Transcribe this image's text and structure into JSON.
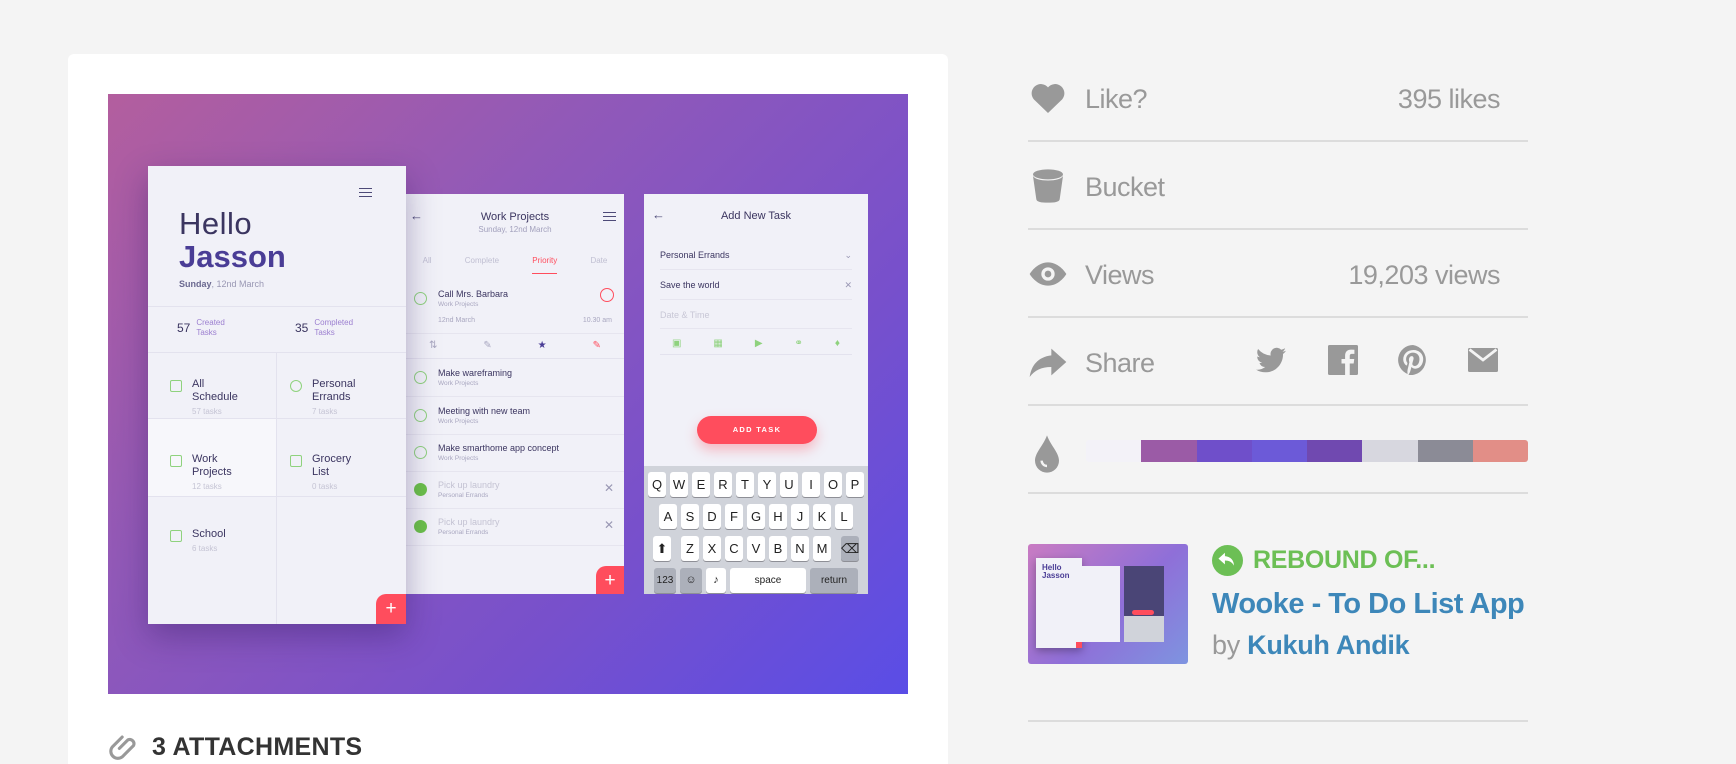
{
  "attachments": {
    "label": "3 ATTACHMENTS"
  },
  "shot": {
    "home": {
      "hello": "Hello",
      "name": "Jasson",
      "day": "Sunday",
      "date": ", 12nd March",
      "created_n": "57",
      "created_l1": "Created",
      "created_l2": "Tasks",
      "completed_n": "35",
      "completed_l1": "Completed",
      "completed_l2": "Tasks",
      "categories": [
        {
          "line1": "All",
          "line2": "Schedule",
          "count": "57 tasks"
        },
        {
          "line1": "Personal",
          "line2": "Errands",
          "count": "7 tasks"
        },
        {
          "line1": "Work",
          "line2": "Projects",
          "count": "12 tasks"
        },
        {
          "line1": "Grocery",
          "line2": "List",
          "count": "0 tasks"
        },
        {
          "line1": "School",
          "line2": "",
          "count": "6 tasks"
        }
      ],
      "fab": "+"
    },
    "projects": {
      "title": "Work Projects",
      "subtitle": "Sunday, 12nd March",
      "tabs": [
        "All",
        "Complete",
        "Priority",
        "Date"
      ],
      "tasks": [
        {
          "title": "Call Mrs. Barbara",
          "sub": "Work Projects",
          "date": "12nd March",
          "time": "10.30 am"
        },
        {
          "title": "Make wareframing",
          "sub": "Work Projects"
        },
        {
          "title": "Meeting with new team",
          "sub": "Work Projects"
        },
        {
          "title": "Make smarthome app concept",
          "sub": "Work Projects"
        },
        {
          "title": "Pick up laundry",
          "sub": "Personal Errands"
        },
        {
          "title": "Pick up laundry",
          "sub": "Personal Errands"
        }
      ]
    },
    "newtask": {
      "title": "Add New Task",
      "category": "Personal Errands",
      "name": "Save the world",
      "datetime_placeholder": "Date & Time",
      "button": "ADD TASK",
      "kb_row1": [
        "Q",
        "W",
        "E",
        "R",
        "T",
        "Y",
        "U",
        "I",
        "O",
        "P"
      ],
      "kb_row2": [
        "A",
        "S",
        "D",
        "F",
        "G",
        "H",
        "J",
        "K",
        "L"
      ],
      "kb_row3": [
        "Z",
        "X",
        "C",
        "V",
        "B",
        "N",
        "M"
      ],
      "kb_num": "123",
      "kb_space": "space",
      "kb_return": "return"
    }
  },
  "sidebar": {
    "like": {
      "label": "Like?",
      "value": "395 likes"
    },
    "bucket": {
      "label": "Bucket"
    },
    "views": {
      "label": "Views",
      "value": "19,203 views"
    },
    "share": {
      "label": "Share",
      "icons": [
        "twitter-icon",
        "facebook-icon",
        "pinterest-icon",
        "email-icon"
      ]
    },
    "palette": [
      "#f3f2f8",
      "#9b5ba6",
      "#6f4fca",
      "#6c5ad8",
      "#7049b0",
      "#d7d7df",
      "#8b8b96",
      "#e28e87"
    ],
    "rebound": {
      "header": "REBOUND OF...",
      "title": "Wooke - To Do List App",
      "by": "by",
      "author": "Kukuh Andik"
    }
  }
}
